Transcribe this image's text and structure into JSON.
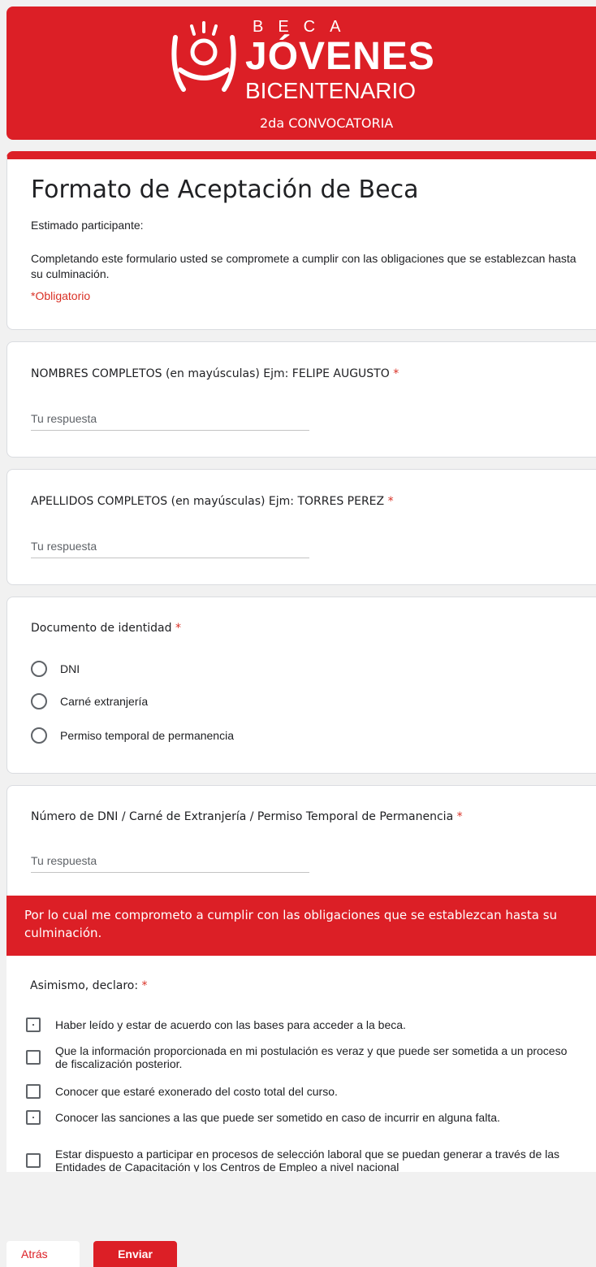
{
  "banner": {
    "brand_top": "BECA",
    "brand_main": "JÓVENES",
    "brand_sub": "BICENTENARIO",
    "edition": "2da CONVOCATORIA",
    "logo_icon": "person-raised-arms-icon"
  },
  "form": {
    "title": "Formato de Aceptación de Beca",
    "greeting": "Estimado participante:",
    "description": "Completando este formulario usted se compromete a cumplir con las obligaciones que se establezcan hasta su culminación.",
    "required_note": "*Obligatorio"
  },
  "questions": {
    "nombres": {
      "label": "NOMBRES COMPLETOS (en mayúsculas) Ejm: FELIPE AUGUSTO",
      "required": "*",
      "placeholder": "Tu respuesta",
      "value": ""
    },
    "apellidos": {
      "label": "APELLIDOS COMPLETOS (en mayúsculas) Ejm: TORRES PEREZ",
      "required": "*",
      "placeholder": "Tu respuesta",
      "value": ""
    },
    "documento": {
      "label": "Documento de identidad",
      "required": "*",
      "options": [
        "DNI",
        "Carné extranjería",
        "Permiso temporal de permanencia"
      ]
    },
    "numero": {
      "label": "Número de DNI / Carné de Extranjería / Permiso Temporal de Permanencia",
      "required": "*",
      "placeholder": "Tu respuesta",
      "value": ""
    }
  },
  "section": {
    "header": "Por lo cual me comprometo a cumplir con las obligaciones que se establezcan hasta su culminación."
  },
  "declaro": {
    "label": "Asimismo, declaro:",
    "required": "*",
    "items": [
      "Haber leído y estar de acuerdo con las bases para acceder a la beca.",
      "Que la información proporcionada en mi postulación es veraz y que puede ser sometida a un proceso de fiscalización posterior.",
      "Conocer que estaré exonerado del costo total del curso.",
      "Conocer las sanciones a las que puede ser sometido en caso de incurrir en alguna falta.",
      "Estar dispuesto a participar en procesos de selección laboral que se puedan generar a través de las Entidades de Capacitación y los Centros de Empleo a nivel nacional"
    ]
  },
  "nav": {
    "back_label": "Atrás",
    "submit_label": "Enviar"
  },
  "colors": {
    "brand_red": "#dc1f26",
    "required_red": "#d93025"
  }
}
